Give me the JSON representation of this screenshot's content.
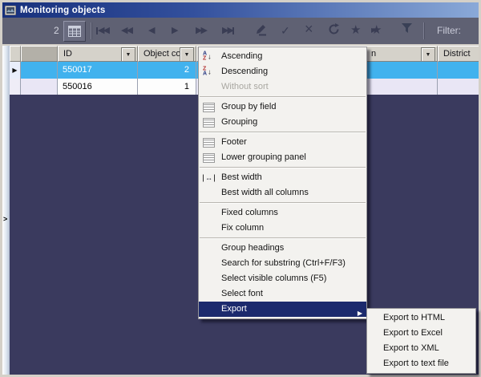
{
  "window": {
    "title": "Monitoring objects"
  },
  "toolbar": {
    "record_count": "2",
    "filter_label": "Filter:",
    "icons": [
      "grid-view-icon",
      "nav-first-icon",
      "nav-fast-prev-icon",
      "nav-prev-icon",
      "nav-next-icon",
      "nav-fast-next-icon",
      "nav-last-icon",
      "edit-pencil-icon",
      "confirm-check-icon",
      "cancel-x-icon",
      "refresh-icon",
      "star-icon",
      "star-arrow-icon",
      "filter-funnel-icon"
    ]
  },
  "grid": {
    "columns": {
      "id": "ID",
      "object_count": "Object co",
      "hidden_column_visible_tail": "n",
      "district": "District"
    },
    "row_indicator": "▶",
    "rows": [
      {
        "id": "550017",
        "object_count": "2"
      },
      {
        "id": "550016",
        "object_count": "1"
      }
    ]
  },
  "menu": {
    "items": [
      {
        "label": "Ascending"
      },
      {
        "label": "Descending"
      },
      {
        "label": "Without sort"
      },
      {
        "label": "Group by field"
      },
      {
        "label": "Grouping"
      },
      {
        "label": "Footer"
      },
      {
        "label": "Lower grouping panel"
      },
      {
        "label": "Best width"
      },
      {
        "label": "Best width all columns"
      },
      {
        "label": "Fixed columns"
      },
      {
        "label": "Fix column"
      },
      {
        "label": "Group headings"
      },
      {
        "label": "Search for substring (Ctrl+F/F3)"
      },
      {
        "label": "Select visible columns (F5)"
      },
      {
        "label": "Select font"
      },
      {
        "label": "Export"
      }
    ]
  },
  "submenu": {
    "items": [
      {
        "label": "Export to HTML"
      },
      {
        "label": "Export to Excel"
      },
      {
        "label": "Export to XML"
      },
      {
        "label": "Export to text file"
      }
    ]
  },
  "colors": {
    "selection_blue": "#41b2ee",
    "menu_highlight_navy": "#1c2a6d",
    "form_background_navy": "#3a3a5e",
    "toolbar_gray": "#5f6173",
    "titlebar_gradient_start": "#17307c",
    "titlebar_gradient_end": "#8aa9d8"
  }
}
